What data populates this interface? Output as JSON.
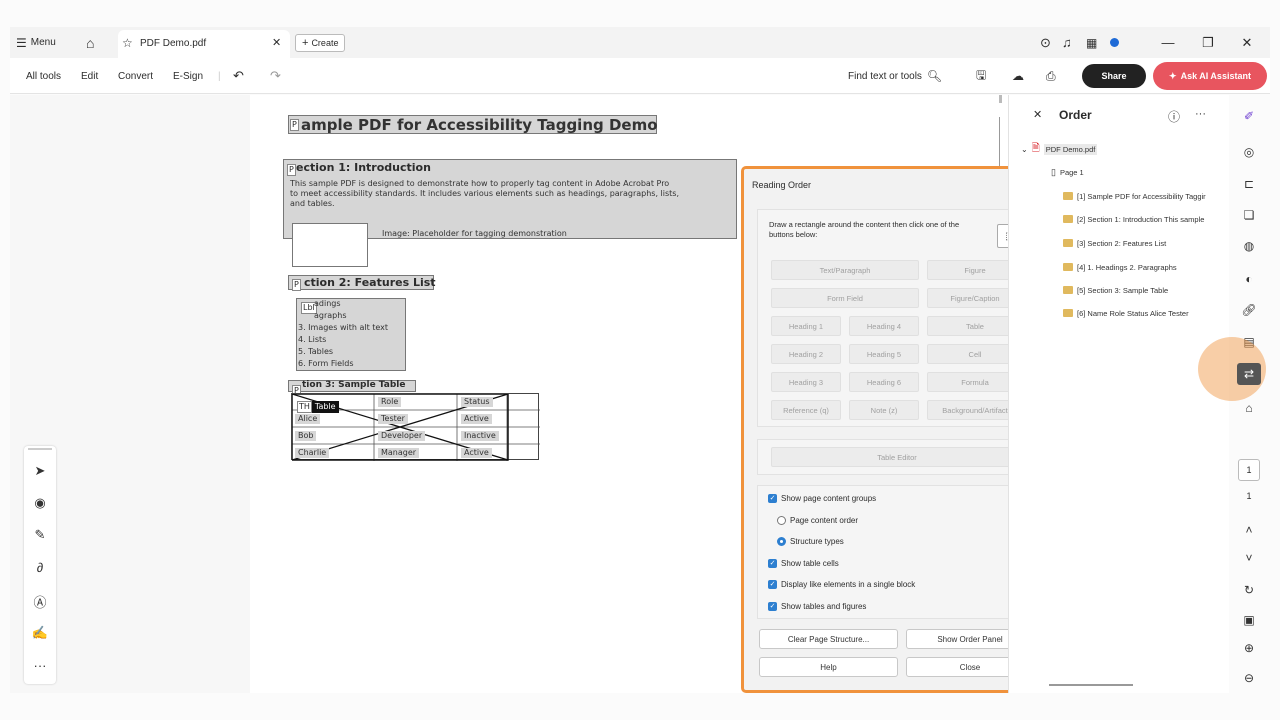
{
  "titlebar": {
    "menu_label": "Menu",
    "tab_title": "PDF Demo.pdf",
    "create_label": "Create"
  },
  "toolbar": {
    "all_tools": "All tools",
    "edit": "Edit",
    "convert": "Convert",
    "esign": "E-Sign",
    "find": "Find text or tools",
    "share": "Share",
    "ask_ai": "Ask AI Assistant"
  },
  "document": {
    "title": "ample PDF for Accessibility Tagging Demo",
    "section1_heading": "ection 1: Introduction",
    "section1_line1": "This sample PDF is designed to demonstrate how to properly tag content in Adobe Acrobat Pro",
    "section1_line2": "to meet accessibility standards. It includes various elements such as headings, paragraphs, lists,",
    "section1_line3": "and tables.",
    "image_placeholder": "Image: Placeholder for tagging demonstration",
    "section2_heading": "ction 2: Features List",
    "list_items": [
      "adings",
      "agraphs",
      "3. Images with alt text",
      "4. Lists",
      "5. Tables",
      "6. Form Fields"
    ],
    "section3_heading": "tion 3: Sample Table",
    "table_rows": [
      [
        "",
        "Role",
        "Status"
      ],
      [
        "Alice",
        "Tester",
        "Active"
      ],
      [
        "Bob",
        "Developer",
        "Inactive"
      ],
      [
        "Charlie",
        "Manager",
        "Active"
      ]
    ],
    "tag_p": "P",
    "tag_lbl": "Lbl",
    "tag_th": "TH",
    "tag_table": "Table"
  },
  "reading_order": {
    "title": "Reading Order",
    "instructions": "Draw a rectangle around the content then click one of the buttons below:",
    "buttons": {
      "text_paragraph": "Text/Paragraph",
      "figure": "Figure",
      "form_field": "Form Field",
      "figure_caption": "Figure/Caption",
      "heading1": "Heading 1",
      "heading4": "Heading 4",
      "table": "Table",
      "heading2": "Heading 2",
      "heading5": "Heading 5",
      "cell": "Cell",
      "heading3": "Heading 3",
      "heading6": "Heading 6",
      "formula": "Formula",
      "reference": "Reference (q)",
      "note": "Note (z)",
      "background": "Background/Artifact",
      "table_editor": "Table Editor"
    },
    "options": {
      "show_groups": "Show page content groups",
      "page_content_order": "Page content order",
      "structure_types": "Structure types",
      "show_cells": "Show table cells",
      "display_like": "Display like elements in a single block",
      "show_tables": "Show tables and figures"
    },
    "actions": {
      "clear": "Clear Page Structure...",
      "show_order": "Show Order Panel",
      "help": "Help",
      "close": "Close"
    }
  },
  "order_panel": {
    "title": "Order",
    "file": "PDF Demo.pdf",
    "page": "Page 1",
    "items": [
      "[1] Sample PDF for Accessibility Taggir",
      "[2] Section 1: Introduction This sample",
      "[3] Section 2: Features List",
      "[4] 1. Headings 2. Paragraphs",
      "[5] Section 3: Sample Table",
      "[6] Name Role Status Alice Tester"
    ]
  },
  "pager": {
    "current": "1",
    "total": "1"
  },
  "colors": {
    "highlight": "#f0923c",
    "ai_button": "#e8555f",
    "checkbox": "#2d7fd0"
  }
}
